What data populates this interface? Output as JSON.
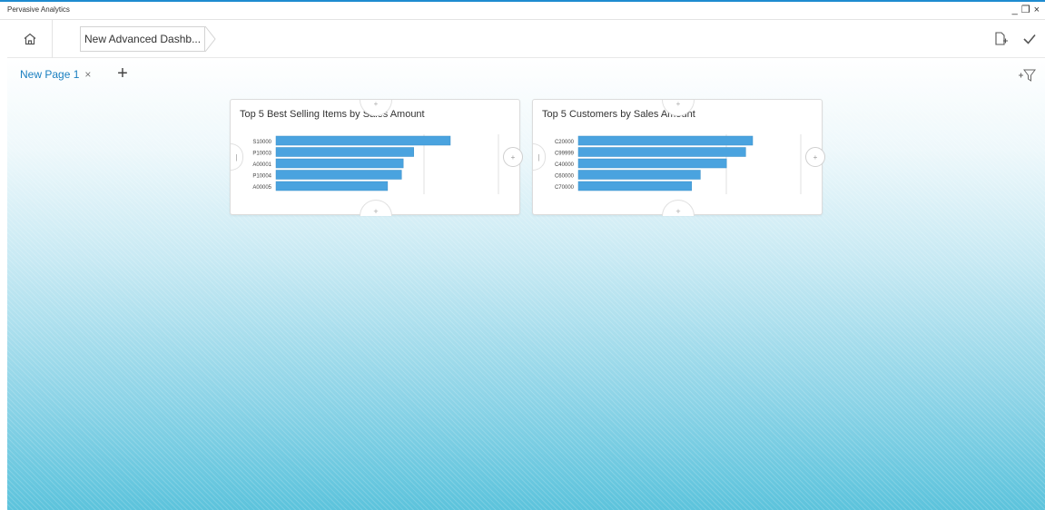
{
  "app": {
    "title": "Pervasive Analytics"
  },
  "window_controls": {
    "minimize": "_",
    "restore": "❒",
    "close": "×"
  },
  "navbar": {
    "home_icon": "home-icon",
    "breadcrumb": "New Advanced Dashb...",
    "actions": [
      {
        "name": "new-document-button",
        "icon": "document-add-icon"
      },
      {
        "name": "confirm-button",
        "icon": "check-icon"
      }
    ]
  },
  "page_tabs": [
    {
      "label": "New Page 1",
      "close": "×"
    }
  ],
  "add_page": "+",
  "add_filter_icon": "add-filter-icon",
  "colors": {
    "accent": "#1e8bd0",
    "bar": "#4aa3df",
    "tab_text": "#1a7fc0"
  },
  "cards": [
    {
      "title": "Top 5 Best Selling Items by Sales Amount",
      "chart_data": {
        "type": "bar",
        "orientation": "horizontal",
        "categories": [
          "S10000",
          "P10003",
          "A00001",
          "P10004",
          "A00005"
        ],
        "values": [
          100,
          79,
          73,
          72,
          64
        ],
        "xlim": [
          0,
          100
        ],
        "title": "Top 5 Best Selling Items by Sales Amount"
      }
    },
    {
      "title": "Top 5 Customers by Sales Amount",
      "chart_data": {
        "type": "bar",
        "orientation": "horizontal",
        "categories": [
          "C20000",
          "C99999",
          "C40000",
          "C60000",
          "C70000"
        ],
        "values": [
          100,
          96,
          85,
          70,
          65
        ],
        "xlim": [
          0,
          100
        ],
        "title": "Top 5 Customers by Sales Amount"
      }
    }
  ]
}
